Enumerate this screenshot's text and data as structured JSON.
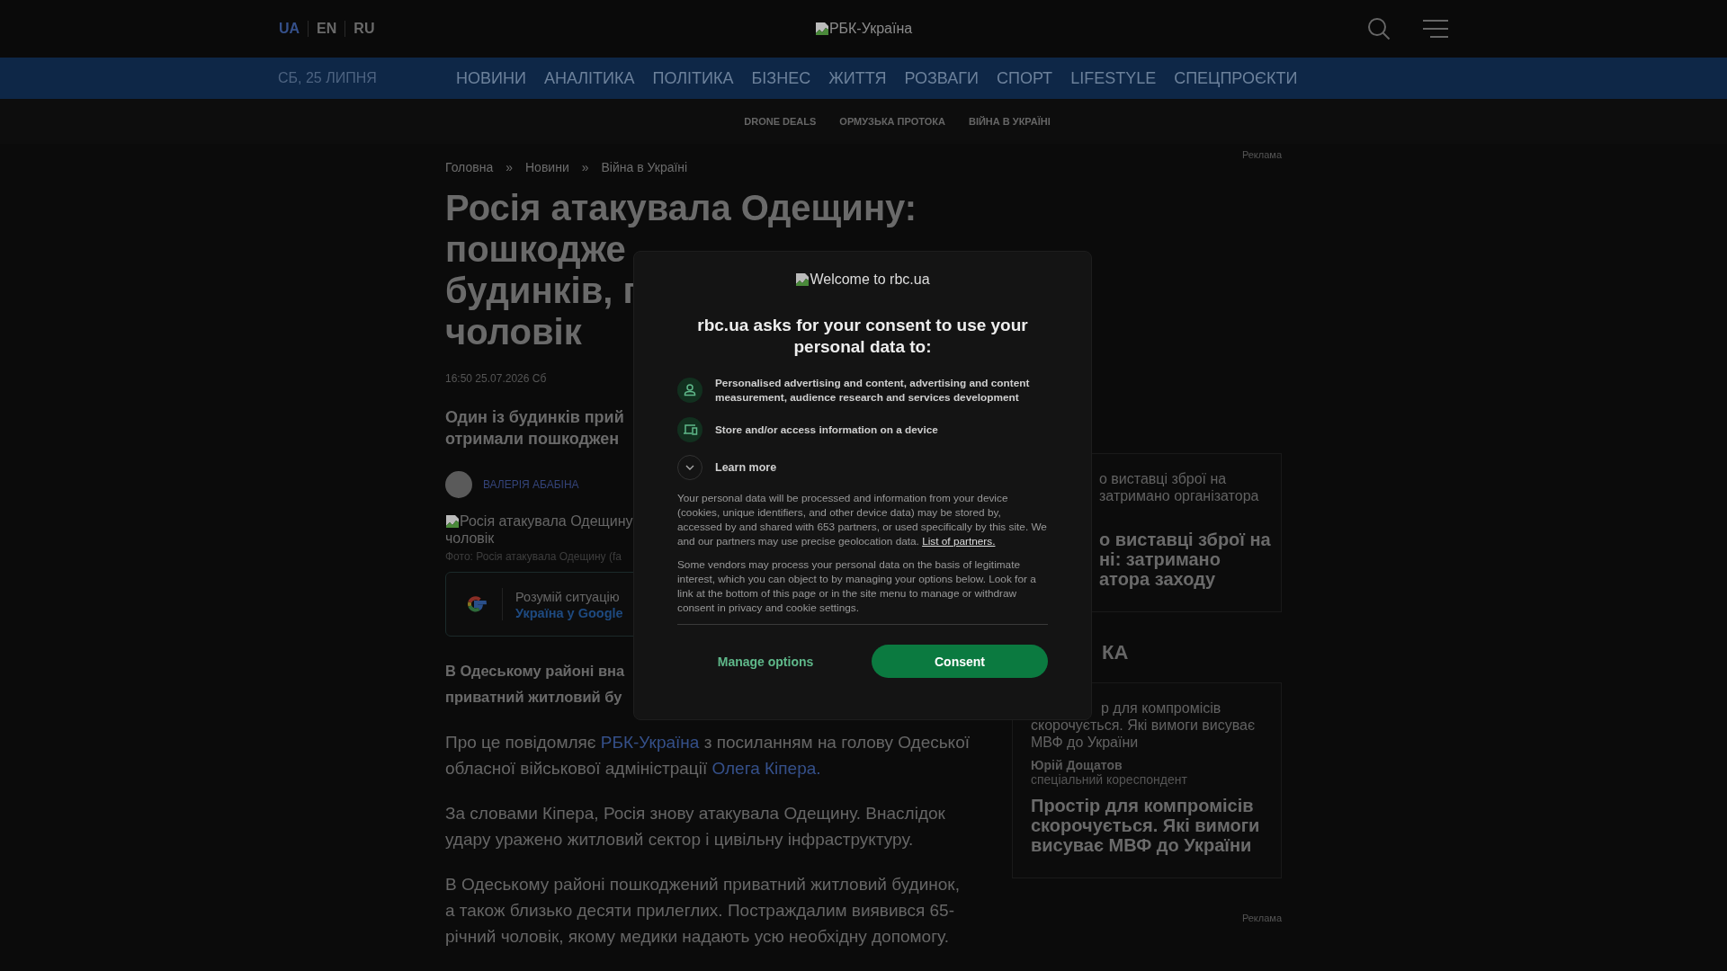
{
  "header": {
    "languages": [
      {
        "label": "UA",
        "selected": true
      },
      {
        "label": "EN",
        "selected": false
      },
      {
        "label": "RU",
        "selected": false
      }
    ],
    "logo_alt": "РБК-Україна"
  },
  "nav": {
    "date": "СБ, 25 ЛИПНЯ",
    "items": [
      "НОВИНИ",
      "АНАЛІТИКА",
      "ПОЛІТИКА",
      "БІЗНЕС",
      "ЖИТТЯ",
      "РОЗВАГИ",
      "СПОРТ",
      "LIFESTYLE",
      "СПЕЦПРОЄКТИ"
    ]
  },
  "subnav": [
    "DRONE DEALS",
    "ОРМУЗЬКА ПРОТОКА",
    "ВІЙНА В УКРАЇНІ"
  ],
  "ad_labels": [
    "Реклама",
    "Реклама"
  ],
  "article": {
    "breadcrumbs": [
      {
        "label": "Головна"
      },
      {
        "label": "Новини"
      },
      {
        "label": "Війна в Україні"
      }
    ],
    "separators": [
      "»",
      "»"
    ],
    "title_lines": [
      "Росія атакувала Одещину:",
      "пошкодже",
      "будинків, г",
      "чоловік"
    ],
    "date": "16:50 25.07.2026 Сб",
    "lead_lines": [
      "Один із будинків прий",
      "отримали пошкоджен"
    ],
    "author": "ВАЛЕРІЯ АБАБІНА",
    "image_alt_lines": [
      "Росія атакувала Одещину",
      "чоловік"
    ],
    "caption": "Фото: Росія атакувала Одещину (fa",
    "google_promo": {
      "text": "Розумій ситуацію",
      "link": "Україна у Google"
    },
    "bold_lines": [
      "В Одеському районі вна",
      "приватний житловий бу"
    ],
    "paragraphs": [
      {
        "segments": [
          {
            "kind": "text",
            "text": "Про це повідомляє "
          },
          {
            "kind": "link",
            "text": "РБК-Україна"
          },
          {
            "kind": "text",
            "text": " з посиланням на голову Одеської обласної військової адміністрації "
          },
          {
            "kind": "link",
            "text": "Олега Кіпера."
          }
        ]
      },
      {
        "segments": [
          {
            "kind": "text",
            "text": "За словами Кіпера, Росія знову атакувала Одещину. Внаслідок удару уражено житловий сектор і цивільну інфраструктуру."
          }
        ]
      },
      {
        "segments": [
          {
            "kind": "text",
            "text": "В Одеському районі пошкоджений приватний житловий будинок, а також близько десяти прилеглих. Постраждалим виявився 65-річний чоловік, якому медики надають усю необхідну допомогу."
          }
        ]
      }
    ]
  },
  "sidebar": {
    "card_1": {
      "summary_lines": [
        "о виставці зброї на",
        "затримано організатора"
      ],
      "title_lines": [
        "о виставці зброї на",
        "ні: затримано",
        "атора заходу"
      ]
    },
    "section_title": "КА",
    "card_2": {
      "summary_lines": [
        {
          "kind": "partial",
          "text": "р для компромісів"
        },
        {
          "kind": "full",
          "text": "скорочується. Які вимоги висуває"
        },
        {
          "kind": "full",
          "text": "МВФ до України"
        }
      ],
      "author": "Юрій Дощатов",
      "role": "спеціальний кореспондент",
      "title": "Простір для компромісів скорочується. Які вимоги висуває МВФ до України"
    }
  },
  "consent": {
    "logo_alt": "Welcome to rbc.ua",
    "heading": "rbc.ua asks for your consent to use your personal data to:",
    "purposes": [
      {
        "kind": "person",
        "text": "Personalised advertising and content, advertising and content measurement, audience research and services development"
      },
      {
        "kind": "device",
        "text": "Store and/or access information on a device"
      }
    ],
    "learn_more": {
      "label": "Learn more",
      "expanded": false
    },
    "body": "Your personal data will be processed and information from your device (cookies, unique identifiers, and other device data) may be stored by, accessed by and shared with 653 partners, or used specifically by this site. We and our partners may use precise geolocation data.",
    "partners_link": "List of partners.",
    "body_2": "Some vendors may process your personal data on the basis of legitimate interest, which you can object to by managing your options below. Look for a link at the bottom of this page or in the site menu to manage or withdraw consent in privacy and cookie settings.",
    "buttons": [
      {
        "kind": "secondary",
        "label": "Manage options"
      },
      {
        "kind": "primary",
        "label": "Consent"
      }
    ]
  }
}
